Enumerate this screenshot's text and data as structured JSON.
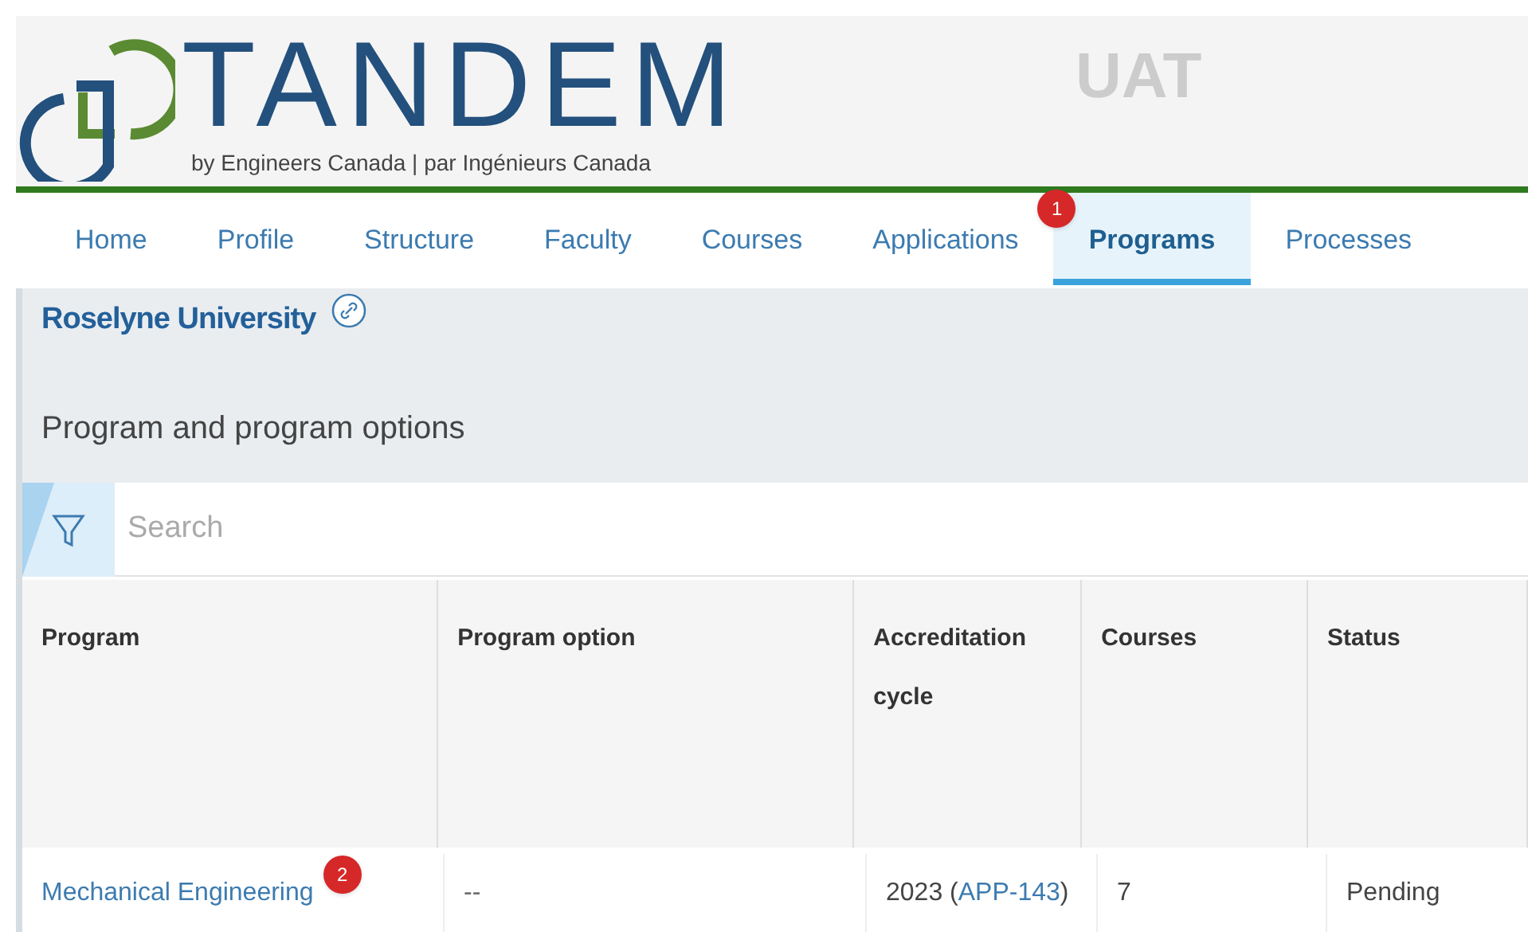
{
  "header": {
    "logo_word": "TANDEM",
    "logo_tagline": "by Engineers Canada | par Ingénieurs Canada",
    "environment": "UAT"
  },
  "nav": [
    {
      "label": "Home",
      "selected": false
    },
    {
      "label": "Profile",
      "selected": false
    },
    {
      "label": "Structure",
      "selected": false
    },
    {
      "label": "Faculty",
      "selected": false
    },
    {
      "label": "Courses",
      "selected": false
    },
    {
      "label": "Applications",
      "selected": false
    },
    {
      "label": "Programs",
      "selected": true,
      "callout": "1"
    },
    {
      "label": "Processes",
      "selected": false
    }
  ],
  "institution": "Roselyne University",
  "section_title": "Program and program options",
  "search": {
    "placeholder": "Search"
  },
  "table": {
    "columns": [
      "Program",
      "Program option",
      "Accreditation cycle",
      "Courses",
      "Status"
    ],
    "rows": [
      {
        "program": "Mechanical Engineering",
        "callout": "2",
        "option": "--",
        "cycle_prefix": "2023 (",
        "cycle_link": "APP-143",
        "cycle_suffix": ")",
        "courses": "7",
        "status": "Pending"
      }
    ]
  }
}
